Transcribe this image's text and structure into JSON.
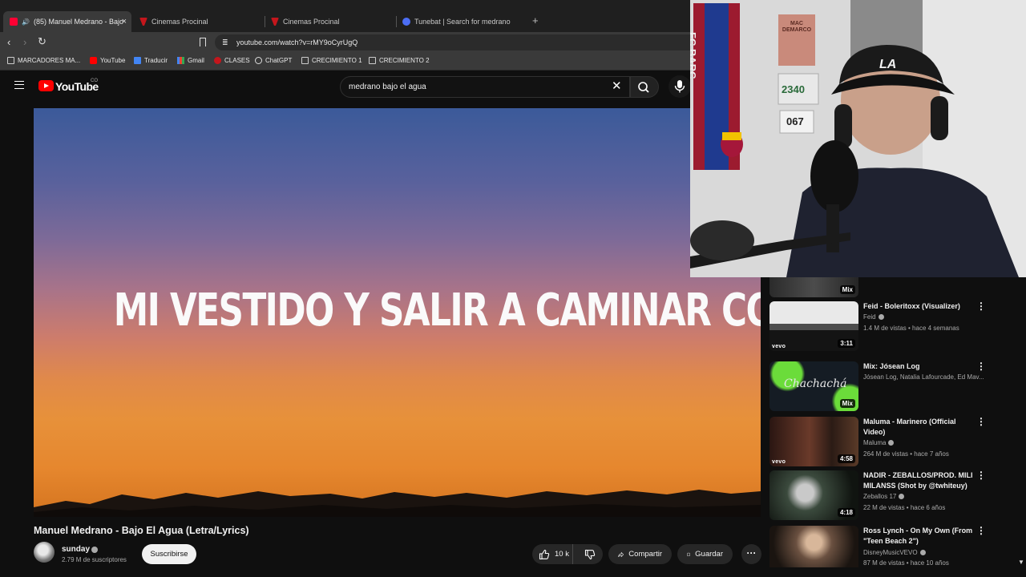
{
  "browser": {
    "tabs": [
      {
        "label": "(85) Manuel Medrano - Bajo",
        "active": true
      },
      {
        "label": "Cinemas Procinal",
        "active": false
      },
      {
        "label": "Cinemas Procinal",
        "active": false
      },
      {
        "label": "Tunebat | Search for medrano",
        "active": false
      }
    ],
    "tab_close": "×",
    "new_tab": "+",
    "url": "youtube.com/watch?v=rMY9oCyrUgQ",
    "bookmarks": [
      "MARCADORES MA...",
      "YouTube",
      "Traducir",
      "Gmail",
      "CLASES",
      "ChatGPT",
      "CRECIMIENTO 1",
      "CRECIMIENTO 2"
    ]
  },
  "youtube": {
    "wordmark": "YouTube",
    "country": "CO",
    "search_query": "medrano bajo el agua",
    "clear_glyph": "✕"
  },
  "video": {
    "lyric": "MI VESTIDO Y SALIR A CAMINAR CONTIGO",
    "title": "Manuel Medrano - Bajo El Agua (Letra/Lyrics)",
    "channel": "sunday",
    "subscribers": "2.79 M de suscriptores",
    "subscribe_label": "Suscribirse",
    "likes": "10 k",
    "share_label": "Compartir",
    "save_label": "Guardar",
    "more_glyph": "···"
  },
  "sidebar": {
    "top_partial_badge": "Mix",
    "items": [
      {
        "title": "Feid - Boleritoxx (Visualizer)",
        "channel": "Feid",
        "meta": "1.4 M de vistas • hace 4 semanas",
        "badge": "3:11",
        "vevo": "vevo"
      },
      {
        "title": "Mix: Jósean Log",
        "channel": "Jósean Log, Natalia Lafourcade, Ed Mav...",
        "meta": "",
        "badge": "Mix",
        "thumb_text": "Chachachá",
        "vevo": ""
      },
      {
        "title": "Maluma - Marinero (Official Video)",
        "channel": "Maluma",
        "meta": "264 M de vistas • hace 7 años",
        "badge": "4:58",
        "vevo": "vevo"
      },
      {
        "title": "NADIR - ZEBALLOS/PROD. MILI MILANSS (Shot by @twhiteuy)",
        "channel": "Zeballos 17",
        "meta": "22 M de vistas • hace 6 años",
        "badge": "4:18",
        "vevo": ""
      },
      {
        "title": "Ross Lynch - On My Own (From \"Teen Beach 2\")",
        "channel": "DisneyMusicVEVO",
        "meta": "87 M de vistas • hace 10 años",
        "badge": "",
        "vevo": ""
      }
    ],
    "kebab": "⋮"
  },
  "webcam": {
    "scarf_text": "FC BARC",
    "poster_text": "MAC DEMARCO",
    "plate_number": "2340",
    "plate_sub": "067",
    "cap_logo": "LA"
  },
  "colors": {
    "accent": "#ff0000",
    "background": "#0f0f0f",
    "chip": "#272727"
  }
}
